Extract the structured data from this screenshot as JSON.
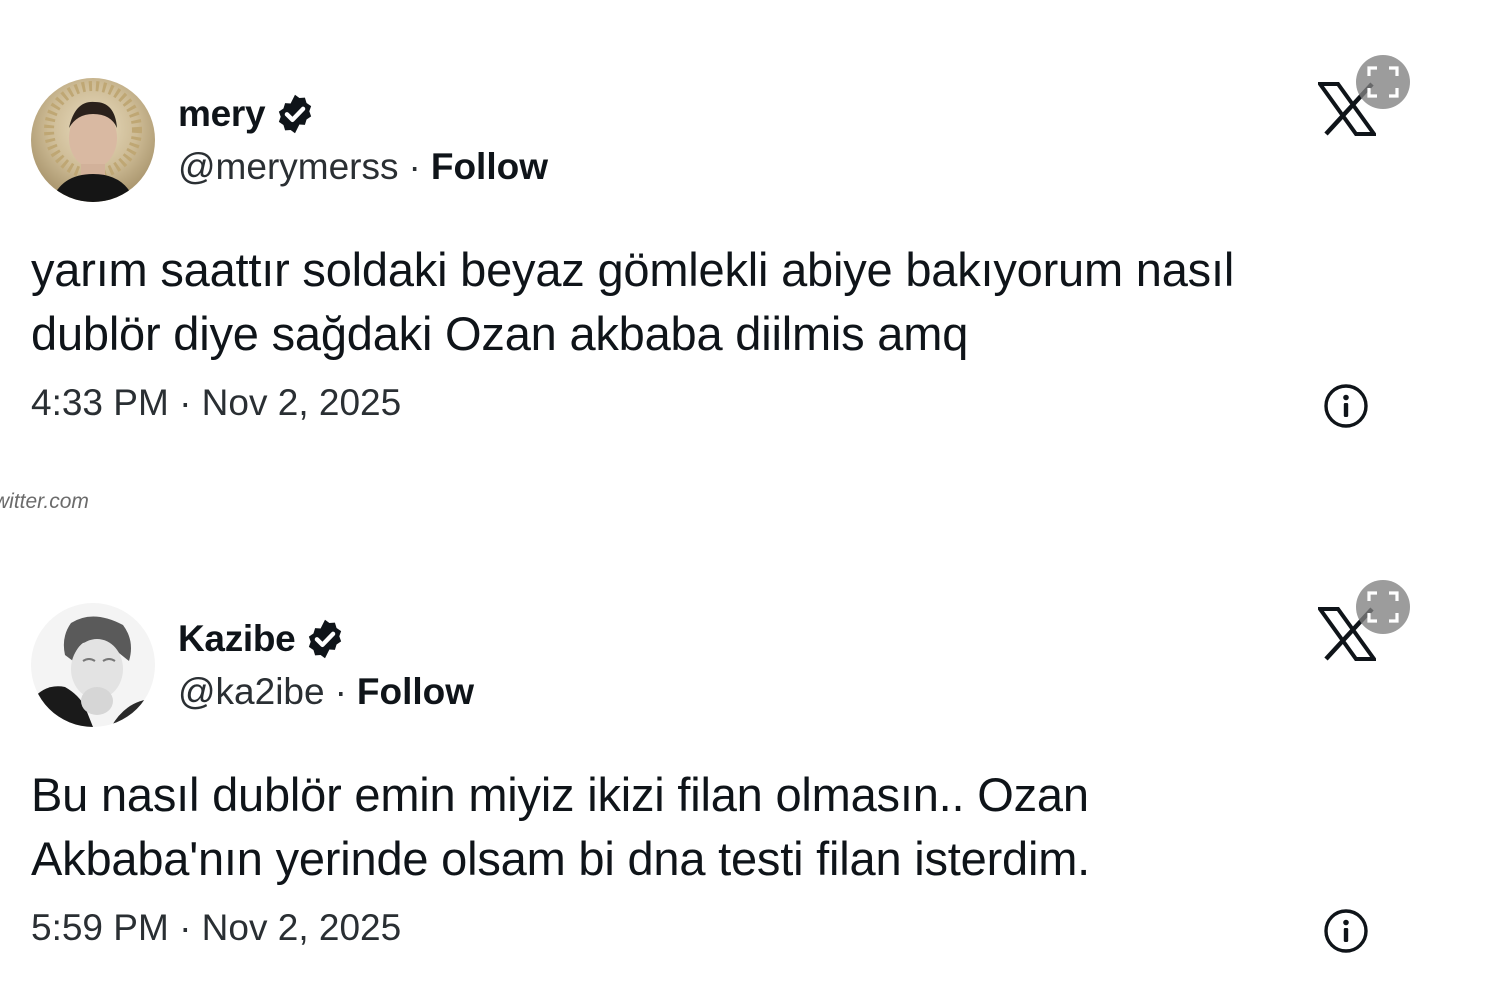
{
  "watermark": "witter.com",
  "tweets": [
    {
      "display_name": "mery",
      "handle": "@merymerss",
      "separator": "·",
      "follow_label": "Follow",
      "verified": true,
      "text_lines": [
        "yarım saattır soldaki beyaz gömlekli abiye bakıyorum nasıl",
        "dublör diye sağdaki Ozan akbaba diilmis amq"
      ],
      "timestamp": "4:33 PM · Nov 2, 2025",
      "brand_icon": "x-logo-icon",
      "info_icon": "info-icon"
    },
    {
      "display_name": "Kazibe",
      "handle": "@ka2ibe",
      "separator": "·",
      "follow_label": "Follow",
      "verified": true,
      "text_lines": [
        "Bu nasıl dublör emin miyiz ikizi filan olmasın.. Ozan",
        "Akbaba'nın yerinde olsam bi dna testi filan isterdim."
      ],
      "timestamp": "5:59 PM · Nov 2, 2025",
      "brand_icon": "x-logo-icon",
      "info_icon": "info-icon"
    }
  ],
  "colors": {
    "text": "#0f1419",
    "muted": "#2a2f33",
    "expand_button": "#808080",
    "background": "#ffffff"
  }
}
